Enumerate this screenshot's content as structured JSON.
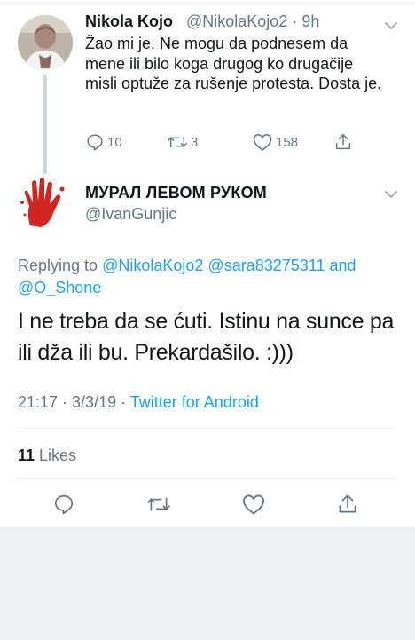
{
  "colors": {
    "accent": "#1da1f2",
    "secondary_text": "#657786",
    "primary_text": "#14171a",
    "divider": "#e6ecf0",
    "thread_line": "#ccd6dd",
    "background": "#eef0f2"
  },
  "parent_tweet": {
    "author_name": "Nikola Kojo",
    "handle_time": "@NikolaKojo2 · 9h",
    "text": "Žao mi je. Ne mogu da podnesem da mene ili bilo koga drugog ko drugačije misli optuže za rušenje protesta. Dosta je.",
    "actions": {
      "reply_icon": "reply-icon",
      "reply_count": "10",
      "retweet_icon": "retweet-icon",
      "retweet_count": "3",
      "like_icon": "like-icon",
      "like_count": "158",
      "share_icon": "share-icon"
    }
  },
  "main_tweet": {
    "author_name": "МУРАЛ ЛЕВОМ РУКОМ",
    "handle": "@IvanGunjic",
    "replying_prefix": "Replying to",
    "replying_to": [
      "@NikolaKojo2",
      "@sara83275311",
      "@O_Shone"
    ],
    "replying_joiner": "and",
    "text": "I ne treba da se ćuti. Istinu na sunce pa ili dža ili bu. Prekardašilo. :)))",
    "timestamp": "21:17 · 3/3/19 ·",
    "source": "Twitter for Android",
    "likes_count": "11",
    "likes_label": "Likes",
    "actions": [
      "reply-icon",
      "retweet-icon",
      "like-icon",
      "share-icon"
    ]
  }
}
